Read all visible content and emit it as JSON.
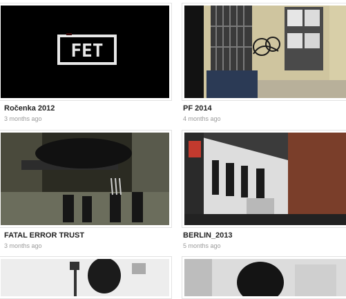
{
  "videos": [
    {
      "title": "Ročenka 2012",
      "age": "3 months ago",
      "thumb_icon": "fet-logo-thumbnail-icon",
      "thumb_text": "FET"
    },
    {
      "title": "PF 2014",
      "age": "4 months ago",
      "thumb_icon": "building-window-graffiti-thumbnail-icon"
    },
    {
      "title": "FATAL ERROR TRUST",
      "age": "3 months ago",
      "thumb_icon": "crowd-legs-thumbnail-icon"
    },
    {
      "title": "BERLIN_2013",
      "age": "5 months ago",
      "thumb_icon": "berlin-building-graffiti-thumbnail-icon"
    },
    {
      "title": "",
      "age": "",
      "thumb_icon": "person-with-sign-thumbnail-icon"
    },
    {
      "title": "",
      "age": "",
      "thumb_icon": "dark-person-thumbnail-icon"
    }
  ]
}
